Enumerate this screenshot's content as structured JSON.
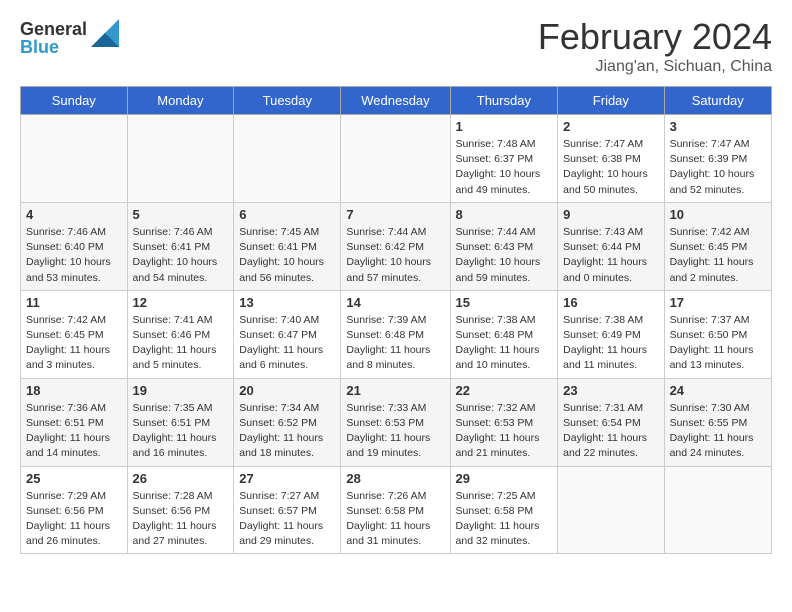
{
  "header": {
    "logo_general": "General",
    "logo_blue": "Blue",
    "month_title": "February 2024",
    "location": "Jiang'an, Sichuan, China"
  },
  "days_of_week": [
    "Sunday",
    "Monday",
    "Tuesday",
    "Wednesday",
    "Thursday",
    "Friday",
    "Saturday"
  ],
  "weeks": [
    [
      {
        "day": "",
        "info": ""
      },
      {
        "day": "",
        "info": ""
      },
      {
        "day": "",
        "info": ""
      },
      {
        "day": "",
        "info": ""
      },
      {
        "day": "1",
        "info": "Sunrise: 7:48 AM\nSunset: 6:37 PM\nDaylight: 10 hours\nand 49 minutes."
      },
      {
        "day": "2",
        "info": "Sunrise: 7:47 AM\nSunset: 6:38 PM\nDaylight: 10 hours\nand 50 minutes."
      },
      {
        "day": "3",
        "info": "Sunrise: 7:47 AM\nSunset: 6:39 PM\nDaylight: 10 hours\nand 52 minutes."
      }
    ],
    [
      {
        "day": "4",
        "info": "Sunrise: 7:46 AM\nSunset: 6:40 PM\nDaylight: 10 hours\nand 53 minutes."
      },
      {
        "day": "5",
        "info": "Sunrise: 7:46 AM\nSunset: 6:41 PM\nDaylight: 10 hours\nand 54 minutes."
      },
      {
        "day": "6",
        "info": "Sunrise: 7:45 AM\nSunset: 6:41 PM\nDaylight: 10 hours\nand 56 minutes."
      },
      {
        "day": "7",
        "info": "Sunrise: 7:44 AM\nSunset: 6:42 PM\nDaylight: 10 hours\nand 57 minutes."
      },
      {
        "day": "8",
        "info": "Sunrise: 7:44 AM\nSunset: 6:43 PM\nDaylight: 10 hours\nand 59 minutes."
      },
      {
        "day": "9",
        "info": "Sunrise: 7:43 AM\nSunset: 6:44 PM\nDaylight: 11 hours\nand 0 minutes."
      },
      {
        "day": "10",
        "info": "Sunrise: 7:42 AM\nSunset: 6:45 PM\nDaylight: 11 hours\nand 2 minutes."
      }
    ],
    [
      {
        "day": "11",
        "info": "Sunrise: 7:42 AM\nSunset: 6:45 PM\nDaylight: 11 hours\nand 3 minutes."
      },
      {
        "day": "12",
        "info": "Sunrise: 7:41 AM\nSunset: 6:46 PM\nDaylight: 11 hours\nand 5 minutes."
      },
      {
        "day": "13",
        "info": "Sunrise: 7:40 AM\nSunset: 6:47 PM\nDaylight: 11 hours\nand 6 minutes."
      },
      {
        "day": "14",
        "info": "Sunrise: 7:39 AM\nSunset: 6:48 PM\nDaylight: 11 hours\nand 8 minutes."
      },
      {
        "day": "15",
        "info": "Sunrise: 7:38 AM\nSunset: 6:48 PM\nDaylight: 11 hours\nand 10 minutes."
      },
      {
        "day": "16",
        "info": "Sunrise: 7:38 AM\nSunset: 6:49 PM\nDaylight: 11 hours\nand 11 minutes."
      },
      {
        "day": "17",
        "info": "Sunrise: 7:37 AM\nSunset: 6:50 PM\nDaylight: 11 hours\nand 13 minutes."
      }
    ],
    [
      {
        "day": "18",
        "info": "Sunrise: 7:36 AM\nSunset: 6:51 PM\nDaylight: 11 hours\nand 14 minutes."
      },
      {
        "day": "19",
        "info": "Sunrise: 7:35 AM\nSunset: 6:51 PM\nDaylight: 11 hours\nand 16 minutes."
      },
      {
        "day": "20",
        "info": "Sunrise: 7:34 AM\nSunset: 6:52 PM\nDaylight: 11 hours\nand 18 minutes."
      },
      {
        "day": "21",
        "info": "Sunrise: 7:33 AM\nSunset: 6:53 PM\nDaylight: 11 hours\nand 19 minutes."
      },
      {
        "day": "22",
        "info": "Sunrise: 7:32 AM\nSunset: 6:53 PM\nDaylight: 11 hours\nand 21 minutes."
      },
      {
        "day": "23",
        "info": "Sunrise: 7:31 AM\nSunset: 6:54 PM\nDaylight: 11 hours\nand 22 minutes."
      },
      {
        "day": "24",
        "info": "Sunrise: 7:30 AM\nSunset: 6:55 PM\nDaylight: 11 hours\nand 24 minutes."
      }
    ],
    [
      {
        "day": "25",
        "info": "Sunrise: 7:29 AM\nSunset: 6:56 PM\nDaylight: 11 hours\nand 26 minutes."
      },
      {
        "day": "26",
        "info": "Sunrise: 7:28 AM\nSunset: 6:56 PM\nDaylight: 11 hours\nand 27 minutes."
      },
      {
        "day": "27",
        "info": "Sunrise: 7:27 AM\nSunset: 6:57 PM\nDaylight: 11 hours\nand 29 minutes."
      },
      {
        "day": "28",
        "info": "Sunrise: 7:26 AM\nSunset: 6:58 PM\nDaylight: 11 hours\nand 31 minutes."
      },
      {
        "day": "29",
        "info": "Sunrise: 7:25 AM\nSunset: 6:58 PM\nDaylight: 11 hours\nand 32 minutes."
      },
      {
        "day": "",
        "info": ""
      },
      {
        "day": "",
        "info": ""
      }
    ]
  ]
}
